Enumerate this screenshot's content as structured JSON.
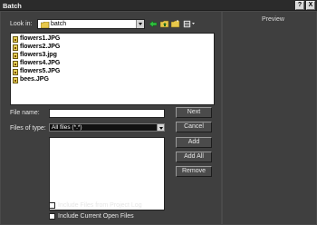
{
  "window": {
    "title": "Batch",
    "help_btn": "?",
    "close_btn": "X"
  },
  "lookin": {
    "label": "Look in:",
    "value": "batch",
    "tools": [
      "back-icon",
      "up-folder-icon",
      "new-folder-icon",
      "view-menu-icon"
    ]
  },
  "files": [
    {
      "name": "flowers1.JPG"
    },
    {
      "name": "flowers2.JPG"
    },
    {
      "name": "flowers3.jpg"
    },
    {
      "name": "flowers4.JPG"
    },
    {
      "name": "flowers5.JPG"
    },
    {
      "name": "bees.JPG"
    }
  ],
  "file_name": {
    "label": "File name:",
    "value": ""
  },
  "files_of_type": {
    "label": "Files of type:",
    "value": "All files (*.*)"
  },
  "buttons": {
    "next": "Next",
    "cancel": "Cancel",
    "add": "Add",
    "add_all": "Add All",
    "remove": "Remove"
  },
  "options": {
    "include_project_log": "Include Files from Project Log",
    "include_open_files": "Include Current Open Files"
  },
  "preview": {
    "label": "Preview"
  },
  "colors": {
    "background": "#3f3f3f",
    "titlebar": "#2b2b2b",
    "accent": "#e8c84a"
  }
}
